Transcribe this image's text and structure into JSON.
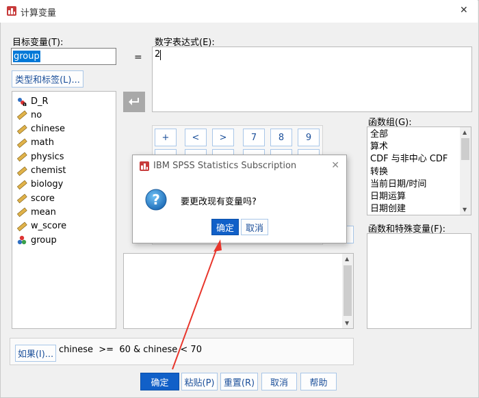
{
  "window": {
    "title": "计算变量",
    "close_glyph": "✕"
  },
  "target_var": {
    "label": "目标变量(T):",
    "value": "group"
  },
  "equals": "=",
  "expression": {
    "label": "数字表达式(E):",
    "value": "2"
  },
  "type_label_button": "类型和标签(L)...",
  "variables": [
    {
      "name": "D_R",
      "icon": "string-nominal-icon"
    },
    {
      "name": "no",
      "icon": "scale-ruler-icon"
    },
    {
      "name": "chinese",
      "icon": "scale-ruler-icon"
    },
    {
      "name": "math",
      "icon": "scale-ruler-icon"
    },
    {
      "name": "physics",
      "icon": "scale-ruler-icon"
    },
    {
      "name": "chemist",
      "icon": "scale-ruler-icon"
    },
    {
      "name": "biology",
      "icon": "scale-ruler-icon"
    },
    {
      "name": "score",
      "icon": "scale-ruler-icon"
    },
    {
      "name": "mean",
      "icon": "scale-ruler-icon"
    },
    {
      "name": "w_score",
      "icon": "scale-ruler-icon"
    },
    {
      "name": "group",
      "icon": "nominal-balls-icon"
    }
  ],
  "keypad_visible": [
    "+",
    "<",
    ">",
    "7",
    "8",
    "9"
  ],
  "function_group": {
    "label": "函数组(G):",
    "items": [
      "全部",
      "算术",
      "CDF 与非中心 CDF",
      "转换",
      "当前日期/时间",
      "日期运算",
      "日期创建"
    ]
  },
  "functions_special": {
    "label": "函数和特殊变量(F):"
  },
  "if_button": "如果(I)...",
  "if_condition": "chinese  >=  60 & chinese < 70",
  "bottom_buttons": {
    "ok": "确定",
    "paste": "粘贴(P)",
    "reset": "重置(R)",
    "cancel": "取消",
    "help": "帮助"
  },
  "dialog": {
    "title": "IBM SPSS Statistics Subscription",
    "message": "要更改现有变量吗?",
    "ok": "确定",
    "cancel": "取消",
    "close_glyph": "✕"
  },
  "colors": {
    "accent": "#1160c8",
    "arrow": "#e8352b",
    "selection": "#0078d7"
  }
}
